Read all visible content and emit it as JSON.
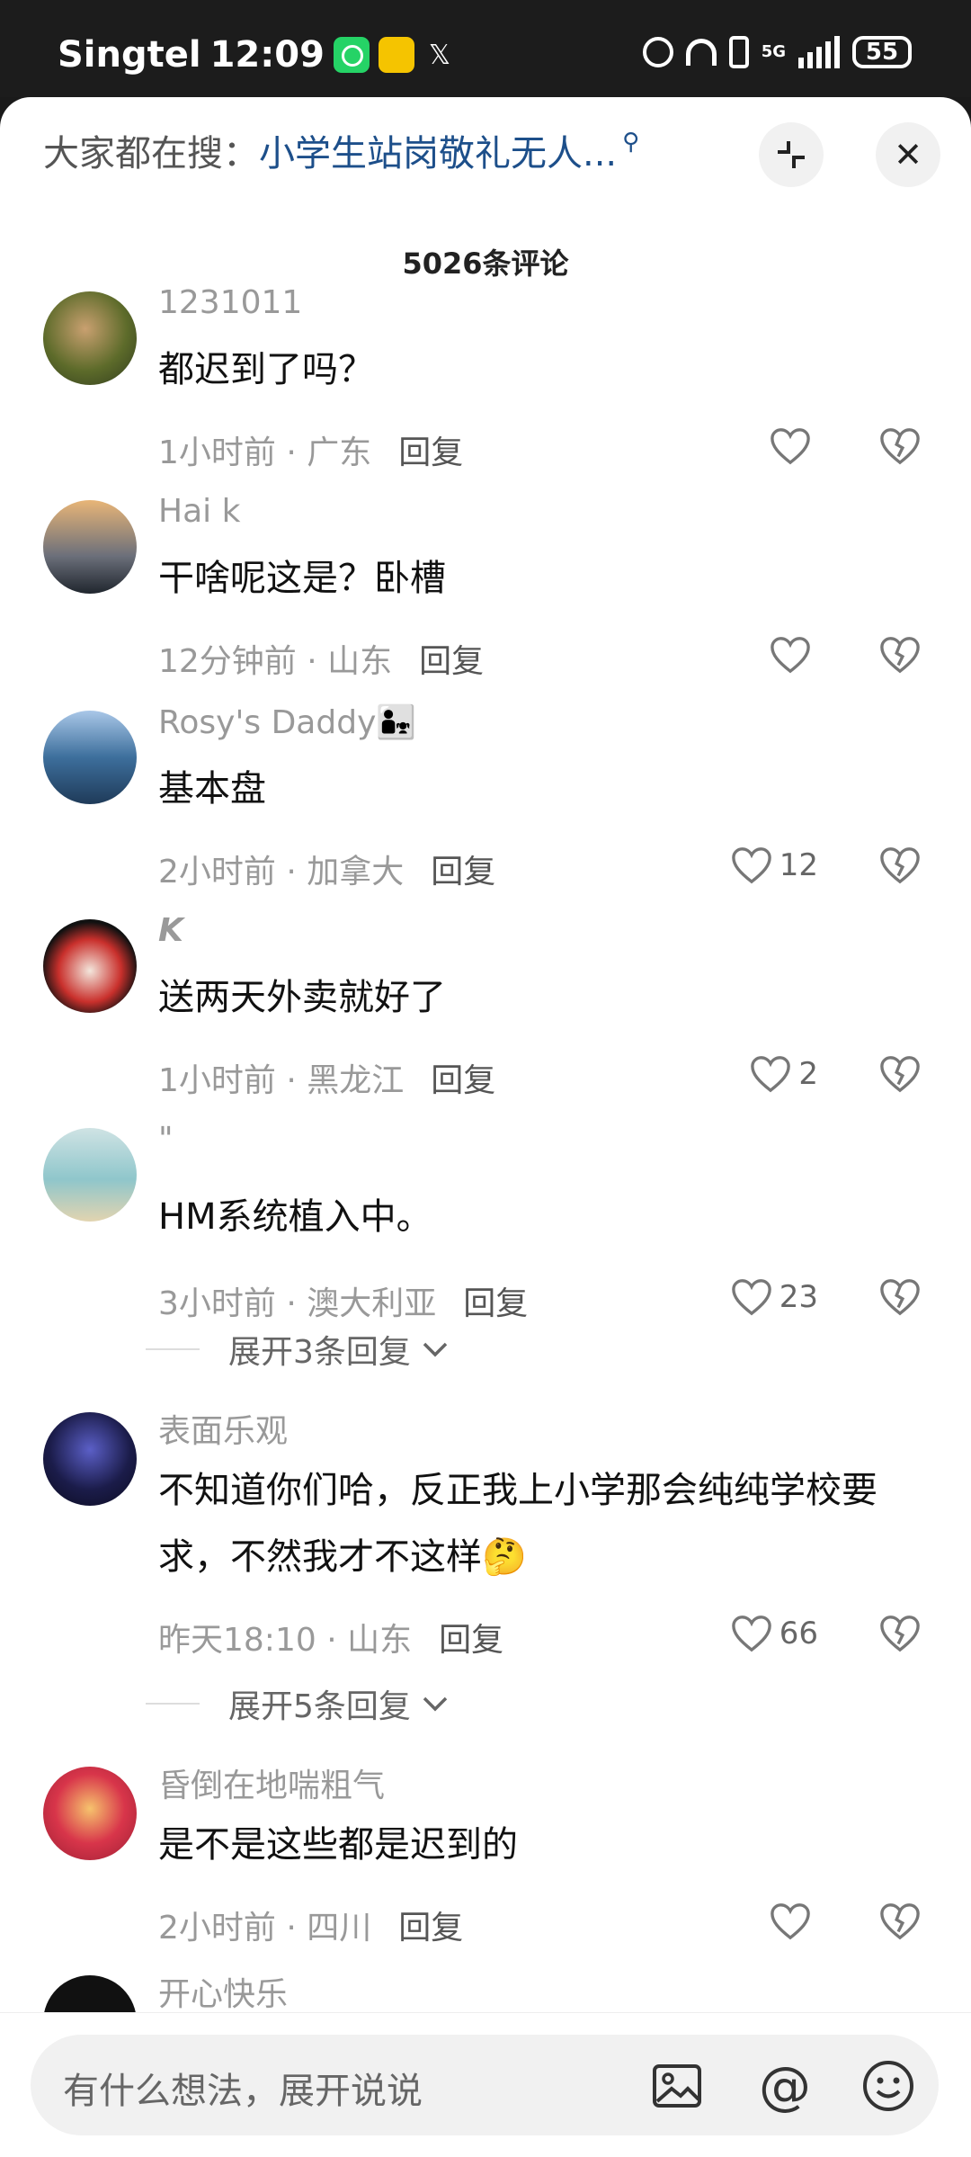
{
  "status_bar": {
    "carrier": "Singtel",
    "time": "12:09",
    "app_icons": [
      "whatsapp-icon",
      "news-app-icon",
      "x-icon"
    ],
    "network": "5G",
    "battery": "55"
  },
  "header": {
    "search_prefix": "大家都在搜：",
    "search_term": "小学生站岗敬礼无人...",
    "shrink_glyph": "⌐",
    "close_glyph": "✕"
  },
  "comments_count_title": "5026条评论",
  "comments": [
    {
      "user": "1231011",
      "text": "都迟到了吗？",
      "time": "1小时前 · 广东",
      "reply": "回复",
      "likes": ""
    },
    {
      "user": "Hai k",
      "text": "干啥呢这是？卧槽",
      "time": "12分钟前 · 山东",
      "reply": "回复",
      "likes": ""
    },
    {
      "user": "Rosy's Daddy👨‍👧",
      "text": "基本盘",
      "time": "2小时前 · 加拿大",
      "reply": "回复",
      "likes": "12"
    },
    {
      "user": "K",
      "text": "送两天外卖就好了",
      "time": "1小时前 · 黑龙江",
      "reply": "回复",
      "likes": "2"
    },
    {
      "user": "\"",
      "text": "HM系统植入中。",
      "time": "3小时前 · 澳大利亚",
      "reply": "回复",
      "likes": "23"
    },
    {
      "user": "表面乐观",
      "text": "不知道你们哈，反正我上小学那会纯纯学校要求，不然我才不这样🤔",
      "time": "昨天18:10 · 山东",
      "reply": "回复",
      "likes": "66"
    },
    {
      "user": "昏倒在地喘粗气",
      "text": "是不是这些都是迟到的",
      "time": "2小时前 · 四川",
      "reply": "回复",
      "likes": ""
    },
    {
      "user": "开心快乐",
      "text": "",
      "time": "",
      "reply": "",
      "likes": ""
    }
  ],
  "expand_replies": [
    "展开3条回复",
    "展开5条回复"
  ],
  "input": {
    "placeholder": "有什么想法，展开说说",
    "at_glyph": "@"
  },
  "colors": {
    "accent_link": "#1d4f8a",
    "sheet_bg": "#ffffff",
    "status_bg": "#1c1c1c"
  }
}
